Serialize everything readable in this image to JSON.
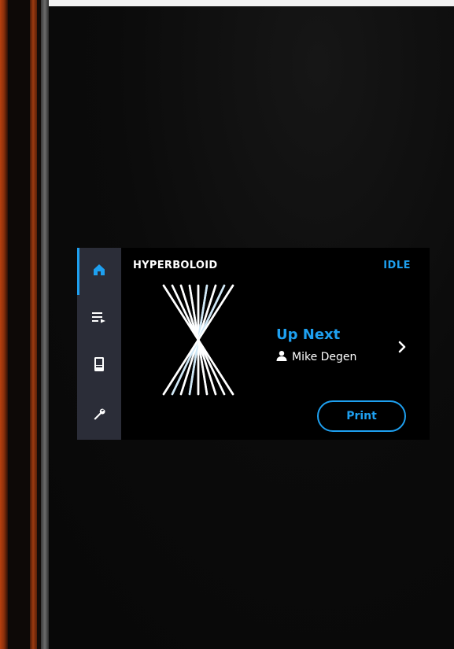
{
  "job": {
    "title": "HYPERBOLOID",
    "status": "IDLE"
  },
  "queue": {
    "label": "Up Next",
    "owner": "Mike Degen"
  },
  "actions": {
    "print_label": "Print"
  },
  "nav": {
    "items": [
      {
        "name": "home",
        "icon": "home-icon",
        "active": true
      },
      {
        "name": "queue",
        "icon": "playlist-icon",
        "active": false
      },
      {
        "name": "material",
        "icon": "cartridge-icon",
        "active": false
      },
      {
        "name": "tools",
        "icon": "wrench-icon",
        "active": false
      }
    ]
  },
  "colors": {
    "accent": "#1ea0f0",
    "nav_background": "#2b2d38",
    "screen_background": "#000000",
    "text": "#ffffff"
  },
  "icons": {
    "owner": "user-icon",
    "next": "chevron-right-icon",
    "preview": "hyperboloid-preview-icon"
  }
}
